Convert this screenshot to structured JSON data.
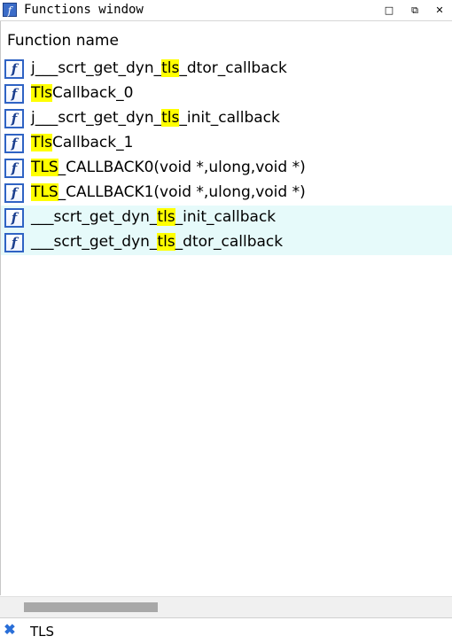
{
  "window": {
    "title": "Functions window",
    "icon": "function-icon",
    "controls": {
      "minimize": "□",
      "restore": "⧉",
      "close": "✕"
    }
  },
  "table": {
    "column_header": "Function name",
    "rows": [
      {
        "segments": [
          {
            "t": "j___scrt_get_dyn_",
            "hl": false
          },
          {
            "t": "tls",
            "hl": true
          },
          {
            "t": "_dtor_callback",
            "hl": false
          }
        ],
        "alt": false
      },
      {
        "segments": [
          {
            "t": "Tls",
            "hl": true
          },
          {
            "t": "Callback_0",
            "hl": false
          }
        ],
        "alt": false
      },
      {
        "segments": [
          {
            "t": "j___scrt_get_dyn_",
            "hl": false
          },
          {
            "t": "tls",
            "hl": true
          },
          {
            "t": "_init_callback",
            "hl": false
          }
        ],
        "alt": false
      },
      {
        "segments": [
          {
            "t": "Tls",
            "hl": true
          },
          {
            "t": "Callback_1",
            "hl": false
          }
        ],
        "alt": false
      },
      {
        "segments": [
          {
            "t": "TLS",
            "hl": true
          },
          {
            "t": "_CALLBACK0(void *,ulong,void *)",
            "hl": false
          }
        ],
        "alt": false
      },
      {
        "segments": [
          {
            "t": "TLS",
            "hl": true
          },
          {
            "t": "_CALLBACK1(void *,ulong,void *)",
            "hl": false
          }
        ],
        "alt": false
      },
      {
        "segments": [
          {
            "t": "___scrt_get_dyn_",
            "hl": false
          },
          {
            "t": "tls",
            "hl": true
          },
          {
            "t": "_init_callback",
            "hl": false
          }
        ],
        "alt": true
      },
      {
        "segments": [
          {
            "t": "___scrt_get_dyn_",
            "hl": false
          },
          {
            "t": "tls",
            "hl": true
          },
          {
            "t": "_dtor_callback",
            "hl": false
          }
        ],
        "alt": true
      }
    ],
    "row_icon": "f"
  },
  "filter": {
    "value": "TLS",
    "clear_icon": "close-filter-icon"
  },
  "colors": {
    "highlight": "#ffff00",
    "alt_row": "#e6fafa",
    "icon_border": "#2f63c4"
  }
}
